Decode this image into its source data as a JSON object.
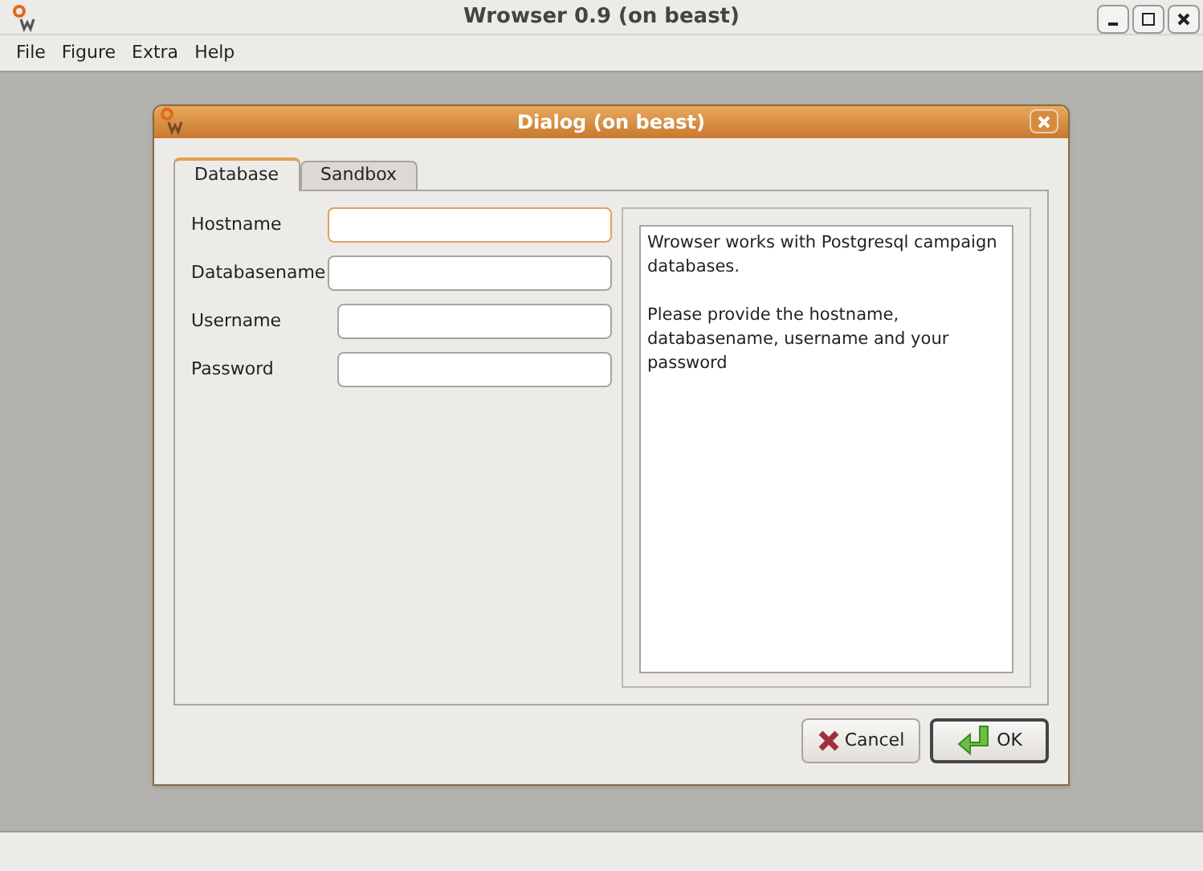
{
  "window": {
    "title": "Wrowser 0.9 (on beast)"
  },
  "menu": [
    "File",
    "Figure",
    "Extra",
    "Help"
  ],
  "dialog": {
    "title": "Dialog (on beast)",
    "tabs": [
      {
        "label": "Database",
        "selected": true
      },
      {
        "label": "Sandbox",
        "selected": false
      }
    ],
    "fields": [
      {
        "label": "Hostname",
        "focused": true
      },
      {
        "label": "Databasename",
        "focused": false
      },
      {
        "label": "Username",
        "focused": false
      },
      {
        "label": "Password",
        "focused": false
      }
    ],
    "info": [
      "Wrowser works with Postgresql campaign databases.",
      "Please provide the hostname, databasename, username and your password"
    ],
    "buttons": [
      {
        "label": "Cancel",
        "kind": "cancel",
        "default": false
      },
      {
        "label": "OK",
        "kind": "ok",
        "default": true
      }
    ]
  }
}
